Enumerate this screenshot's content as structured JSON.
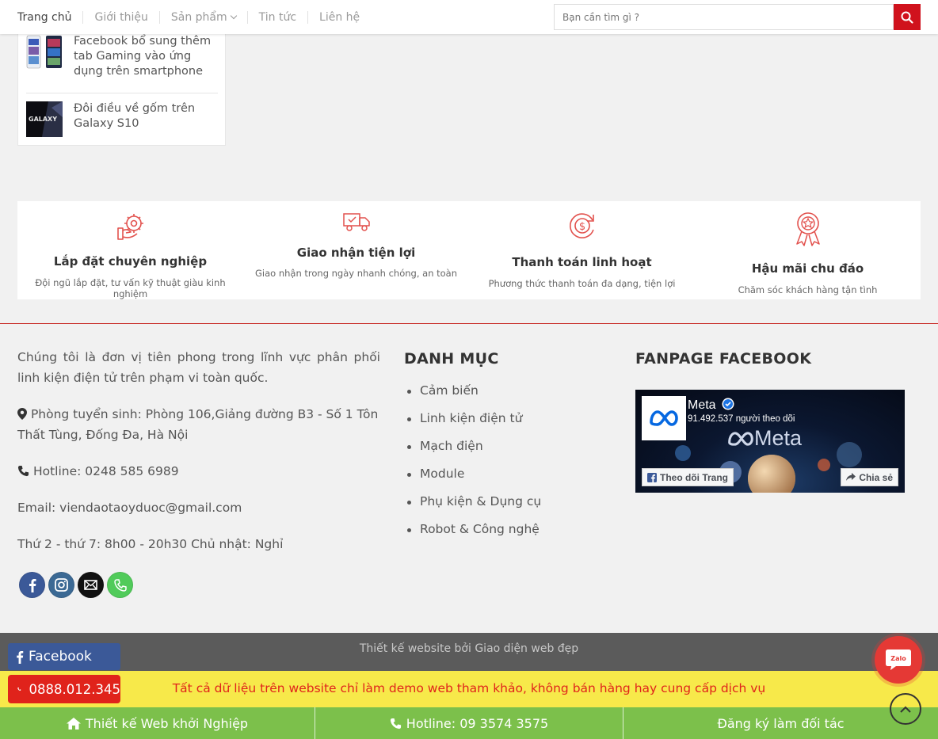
{
  "nav": {
    "items": [
      {
        "label": "Trang chủ"
      },
      {
        "label": "Giới thiệu"
      },
      {
        "label": "Sản phẩm"
      },
      {
        "label": "Tin tức"
      },
      {
        "label": "Liên hệ"
      }
    ],
    "search_placeholder": "Bạn cần tìm gì ?"
  },
  "recent_posts": [
    {
      "title": "Facebook bổ sung thêm tab Gaming vào ứng dụng trên smartphone",
      "thumb_text": ""
    },
    {
      "title": "Đôi điều về gốm trên Galaxy S10",
      "thumb_text": "GALAXY"
    }
  ],
  "features": [
    {
      "title": "Lắp đặt chuyên nghiệp",
      "desc": "Đội ngũ lắp đặt, tư vấn kỹ thuật giàu kinh nghiệm",
      "icon": "installation-icon"
    },
    {
      "title": "Giao nhận tiện lợi",
      "desc": "Giao nhận trong ngày nhanh chóng, an toàn",
      "icon": "delivery-truck-icon"
    },
    {
      "title": "Thanh toán linh hoạt",
      "desc": "Phương thức thanh toán đa dạng, tiện lợi",
      "icon": "payment-cycle-icon"
    },
    {
      "title": "Hậu mãi chu đáo",
      "desc": "Chăm sóc khách hàng tận tình",
      "icon": "award-ribbon-icon"
    }
  ],
  "footer": {
    "intro": "Chúng tôi là đơn vị tiên phong trong lĩnh vực phân phối linh kiện điện tử trên phạm vi toàn quốc.",
    "address": "Phòng tuyển sinh: Phòng 106,Giảng đường B3 - Số 1 Tôn Thất Tùng, Đống Đa, Hà Nội",
    "hotline": "Hotline: 0248 585 6989",
    "email": " Email: viendaotaoyduoc@gmail.com",
    "hours": " Thứ 2 - thứ 7: 8h00 - 20h30 Chủ nhật: Nghỉ",
    "category_title": "DANH MỤC",
    "categories": [
      "Cảm biến",
      "Linh kiện điện tử",
      "Mạch điện",
      "Module",
      "Phụ kiện & Dụng cụ",
      "Robot & Công nghệ"
    ],
    "fanpage_title": "FANPAGE FACEBOOK",
    "fanpage": {
      "name": "Meta",
      "followers": "91.492.537 người theo dõi",
      "wordmark": "Meta",
      "follow_label": "Theo dõi Trang",
      "share_label": "Chia sẻ"
    },
    "socials": [
      {
        "icon": "facebook-icon",
        "color": "#3b5998"
      },
      {
        "icon": "instagram-icon",
        "color": "#3b6994"
      },
      {
        "icon": "email-icon",
        "color": "#111111"
      },
      {
        "icon": "phone-icon",
        "color": "#51cb5a"
      }
    ]
  },
  "credit": "Thiết kế website bởi Giao diện web đẹp",
  "notice": "Tất cả dữ liệu trên website chỉ làm demo web tham khảo, không bán hàng hay cung cấp dịch vụ",
  "floating": {
    "facebook_label": "Facebook",
    "phone_label": "0888.012.345",
    "zalo_label": "Zalo"
  },
  "bottom_bar": [
    {
      "label": "Thiết kế Web khởi Nghiệp",
      "icon": "home-icon"
    },
    {
      "label": "Hotline: 09 3574 3575",
      "icon": "phone-icon"
    },
    {
      "label": "Đăng ký làm đối tác",
      "icon": ""
    }
  ],
  "colors": {
    "accent": "#d0121d",
    "green_bar": "#7cc04b",
    "notice_bg": "#f7e94a",
    "credit_bg": "#5b5b5b"
  }
}
